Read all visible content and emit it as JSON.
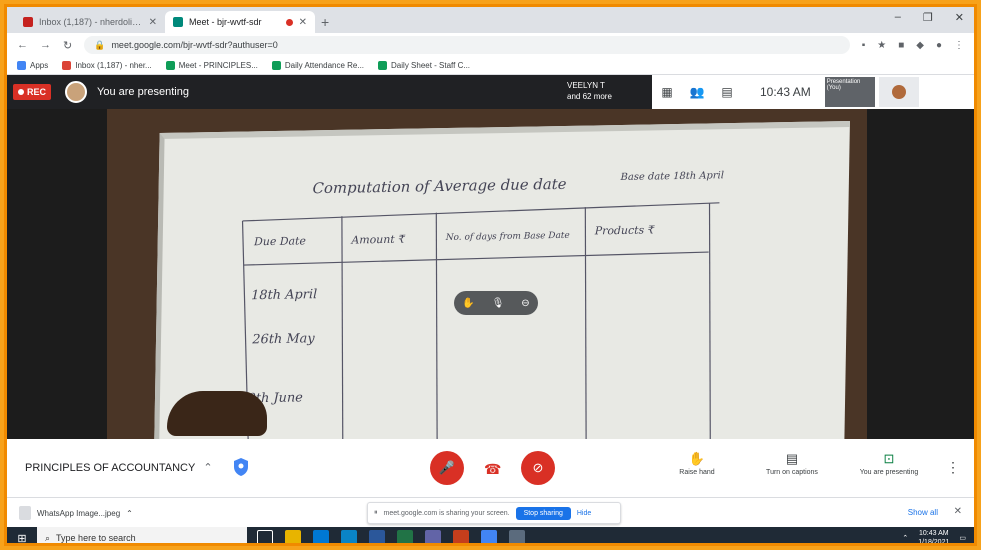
{
  "browser": {
    "tabs": [
      {
        "title": "Inbox (1,187) - nherdolia@stu...",
        "active": false
      },
      {
        "title": "Meet - bjr-wvtf-sdr",
        "active": true
      }
    ],
    "new_tab": "+",
    "window_controls": [
      "–",
      "❐",
      "✕"
    ],
    "url": "meet.google.com/bjr-wvtf-sdr?authuser=0",
    "bookmarks": [
      "Apps",
      "Inbox (1,187) - nher...",
      "Meet - PRINCIPLES...",
      "Daily Attendance Re...",
      "Daily Sheet - Staff C..."
    ]
  },
  "meet": {
    "rec_label": "REC",
    "presenting_banner": "You are presenting",
    "viewer_name": "VEELYN T",
    "viewer_sub": "and 62 more",
    "time": "10:43 AM",
    "thumb_label": "Presentation (You)",
    "thumb_user": "You",
    "meeting_name": "PRINCIPLES OF ACCOUNTANCY",
    "controls": [
      {
        "label": "Raise hand",
        "icon": "✋"
      },
      {
        "label": "Turn on captions",
        "icon": "▤"
      },
      {
        "label": "You are presenting",
        "icon": "⊡"
      }
    ]
  },
  "whiteboard": {
    "title": "Computation of Average due date",
    "corner_note": "Base date 18th April",
    "headers": [
      "Due Date",
      "Amount ₹",
      "No. of days from Base Date",
      "Products ₹"
    ],
    "rows": [
      "18th April",
      "26th May",
      "30th June"
    ]
  },
  "downloads": {
    "file": "WhatsApp Image...jpeg",
    "share_text": "meet.google.com is sharing your screen.",
    "stop_label": "Stop sharing",
    "hide_label": "Hide",
    "show_all": "Show all"
  },
  "taskbar": {
    "search_placeholder": "Type here to search",
    "time": "10:43 AM",
    "date": "1/18/2021"
  }
}
